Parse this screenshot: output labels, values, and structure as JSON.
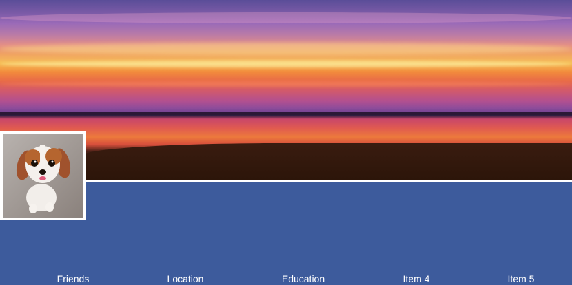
{
  "cover": {
    "image": "sunset-over-sea-photo"
  },
  "profile": {
    "image": "dog-photo"
  },
  "colors": {
    "banner": "#3d5b9c",
    "text": "#ffffff",
    "frame": "#ffffff"
  },
  "nav": {
    "items": [
      {
        "label": "Friends"
      },
      {
        "label": "Location"
      },
      {
        "label": "Education"
      },
      {
        "label": "Item 4"
      },
      {
        "label": "Item 5"
      }
    ]
  }
}
